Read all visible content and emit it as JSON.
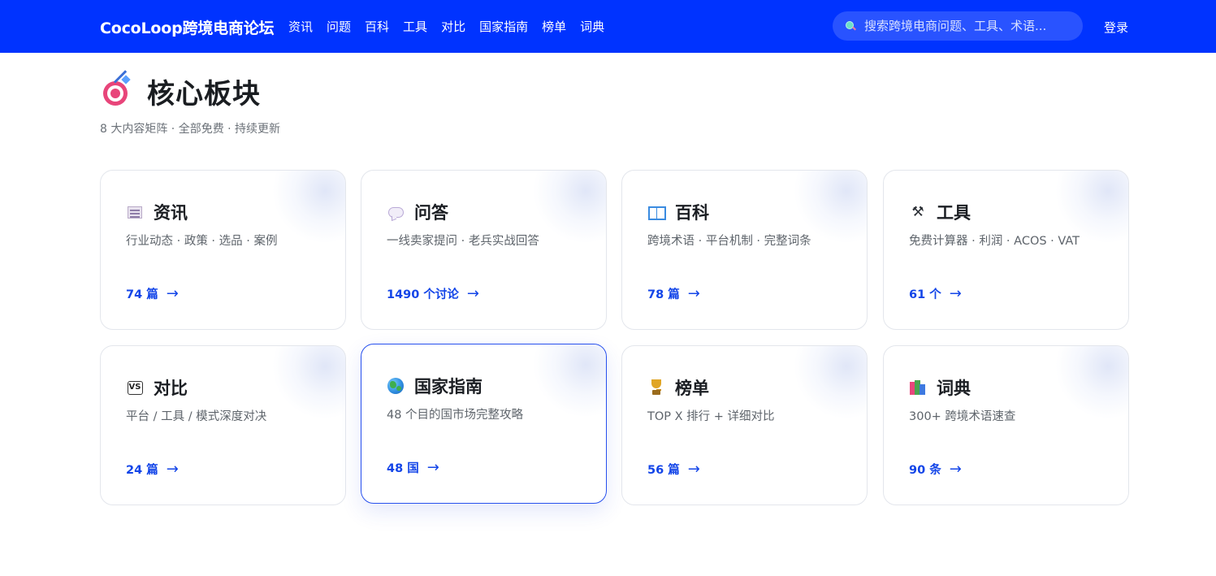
{
  "header": {
    "brand": "CocoLoop跨境电商论坛",
    "nav": [
      "资讯",
      "问题",
      "百科",
      "工具",
      "对比",
      "国家指南",
      "榜单",
      "词典"
    ],
    "search_placeholder": "搜索跨境电商问题、工具、术语...",
    "login": "登录",
    "bg_color": "#0033ff"
  },
  "section": {
    "icon": "target-icon",
    "title": "核心板块",
    "subtitle": "8 大内容矩阵 · 全部免费 · 持续更新"
  },
  "cards": [
    {
      "icon": "newspaper-icon",
      "title": "资讯",
      "desc": "行业动态 · 政策 · 选品 · 案例",
      "count": "74 篇",
      "arrow": "→"
    },
    {
      "icon": "speech-bubble-icon",
      "title": "问答",
      "desc": "一线卖家提问 · 老兵实战回答",
      "count": "1490 个讨论",
      "arrow": "→"
    },
    {
      "icon": "open-book-icon",
      "title": "百科",
      "desc": "跨境术语 · 平台机制 · 完整词条",
      "count": "78 篇",
      "arrow": "→"
    },
    {
      "icon": "tools-icon",
      "title": "工具",
      "desc": "免费计算器 · 利润 · ACOS · VAT",
      "count": "61 个",
      "arrow": "→"
    },
    {
      "icon": "vs-icon",
      "title": "对比",
      "desc": "平台 / 工具 / 模式深度对决",
      "count": "24 篇",
      "arrow": "→"
    },
    {
      "icon": "globe-icon",
      "title": "国家指南",
      "desc": "48 个目的国市场完整攻略",
      "count": "48 国",
      "arrow": "→",
      "active": true
    },
    {
      "icon": "trophy-icon",
      "title": "榜单",
      "desc": "TOP X 排行 + 详细对比",
      "count": "56 篇",
      "arrow": "→"
    },
    {
      "icon": "books-icon",
      "title": "词典",
      "desc": "300+ 跨境术语速查",
      "count": "90 条",
      "arrow": "→"
    }
  ],
  "colors": {
    "accent": "#1345e8",
    "active_border": "#2750ee"
  }
}
